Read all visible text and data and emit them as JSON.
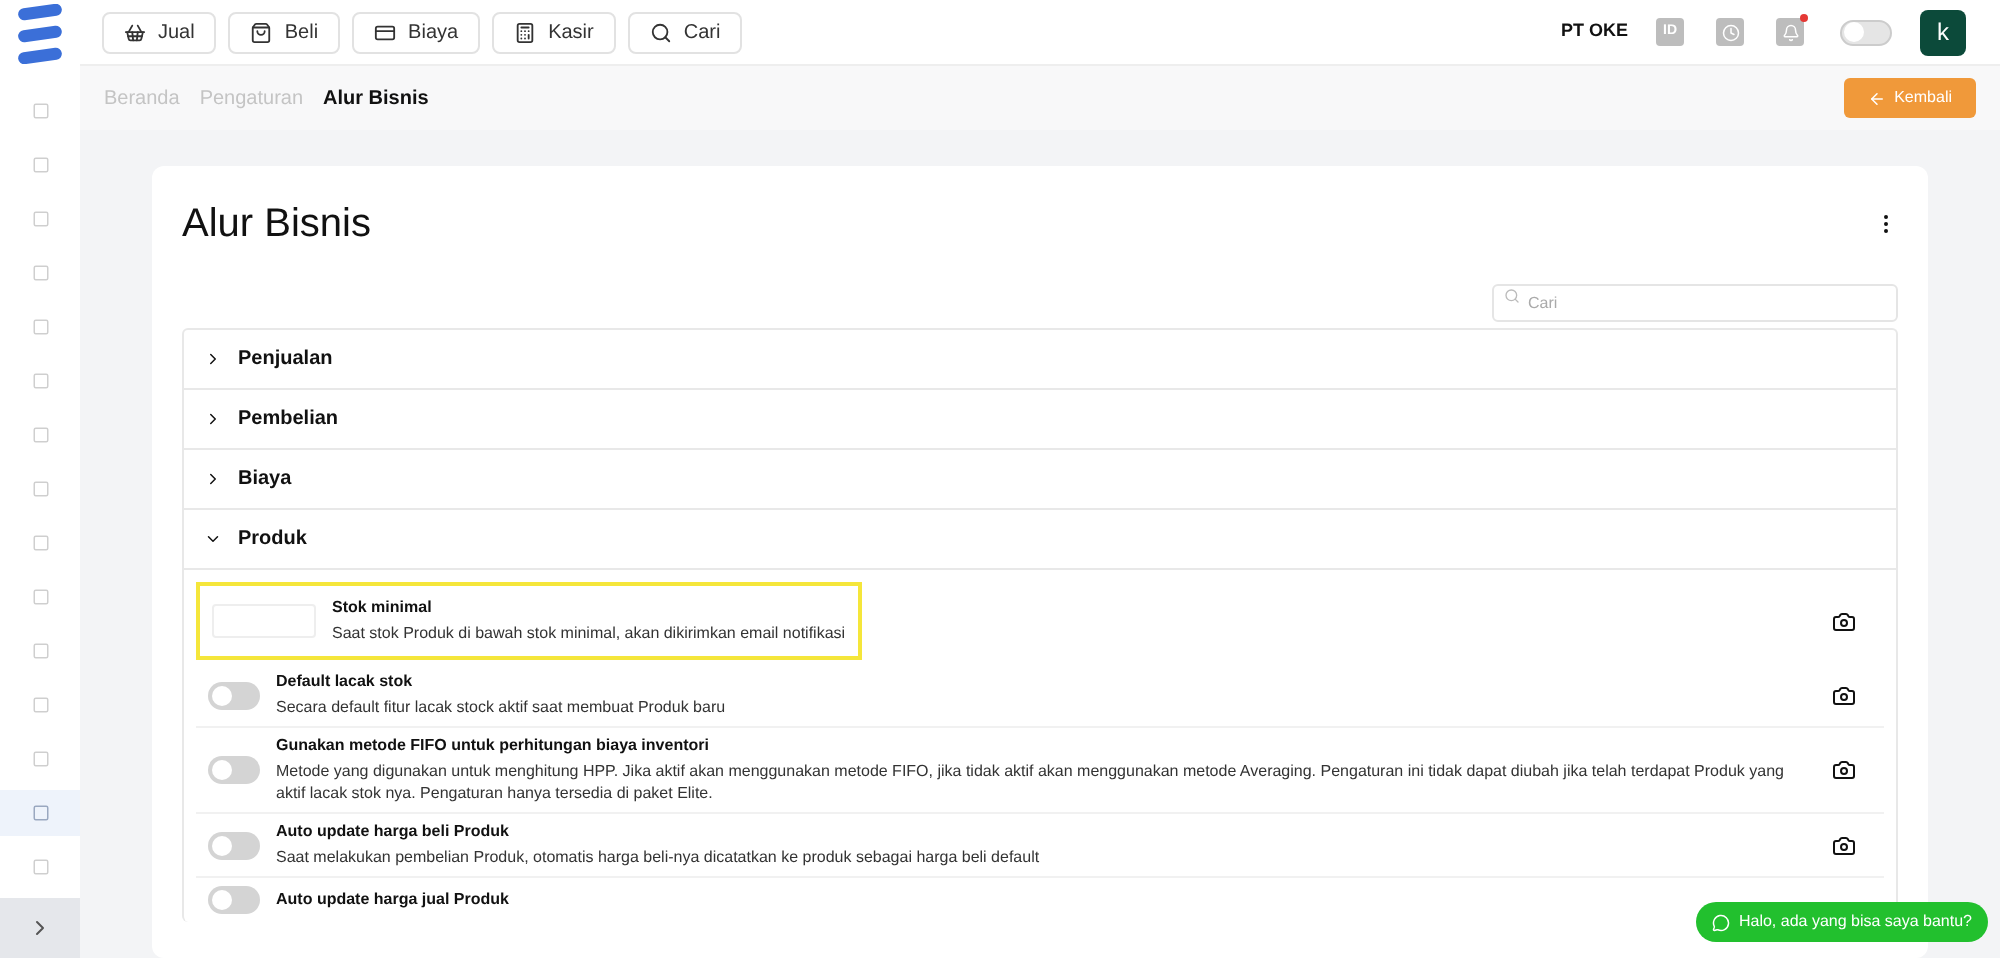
{
  "topbar": {
    "buttons": [
      {
        "label": "Jual",
        "kind": "basket"
      },
      {
        "label": "Beli",
        "kind": "bag"
      },
      {
        "label": "Biaya",
        "kind": "card"
      },
      {
        "label": "Kasir",
        "kind": "register"
      },
      {
        "label": "Cari",
        "kind": "search"
      }
    ],
    "company": "PT OKE",
    "language": "ID",
    "theme_toggle": {
      "on": false
    },
    "avatar": "k"
  },
  "sidebar": {
    "items": [
      {
        "selected": false
      },
      {
        "selected": false
      },
      {
        "selected": false
      },
      {
        "selected": false
      },
      {
        "selected": false
      },
      {
        "selected": false
      },
      {
        "selected": false
      },
      {
        "selected": false
      },
      {
        "selected": false
      },
      {
        "selected": false
      },
      {
        "selected": false
      },
      {
        "selected": false
      },
      {
        "selected": false
      },
      {
        "selected": true
      },
      {
        "selected": false
      }
    ]
  },
  "breadcrumb": [
    "Beranda",
    "Pengaturan",
    "Alur Bisnis"
  ],
  "back_button": "Kembali",
  "page_title": "Alur Bisnis",
  "search": {
    "placeholder": "Cari"
  },
  "sections": [
    {
      "title": "Penjualan",
      "expanded": false
    },
    {
      "title": "Pembelian",
      "expanded": false
    },
    {
      "title": "Biaya",
      "expanded": false
    },
    {
      "title": "Produk",
      "expanded": true
    }
  ],
  "settings": [
    {
      "kind": "input",
      "title": "Stok minimal",
      "description": "Saat stok Produk di bawah stok minimal, akan dikirimkan email notifikasi",
      "highlighted": true
    },
    {
      "kind": "toggle",
      "title": "Default lacak stok",
      "description": "Secara default fitur lacak stock aktif saat membuat Produk baru",
      "on": false,
      "highlighted": false
    },
    {
      "kind": "toggle",
      "title": "Gunakan metode FIFO untuk perhitungan biaya inventori",
      "description": "Metode yang digunakan untuk menghitung HPP. Jika aktif akan menggunakan metode FIFO, jika tidak aktif akan menggunakan metode Averaging. Pengaturan ini tidak dapat diubah jika telah terdapat Produk yang aktif lacak stok nya. Pengaturan hanya tersedia di paket Elite.",
      "on": false,
      "highlighted": false
    },
    {
      "kind": "toggle",
      "title": "Auto update harga beli Produk",
      "description": "Saat melakukan pembelian Produk, otomatis harga beli-nya dicatatkan ke produk sebagai harga beli default",
      "on": false,
      "highlighted": false
    },
    {
      "kind": "toggle",
      "title": "Auto update harga jual Produk",
      "on": false,
      "highlighted": false
    }
  ],
  "chat_button": "Halo, ada yang bisa saya bantu?"
}
